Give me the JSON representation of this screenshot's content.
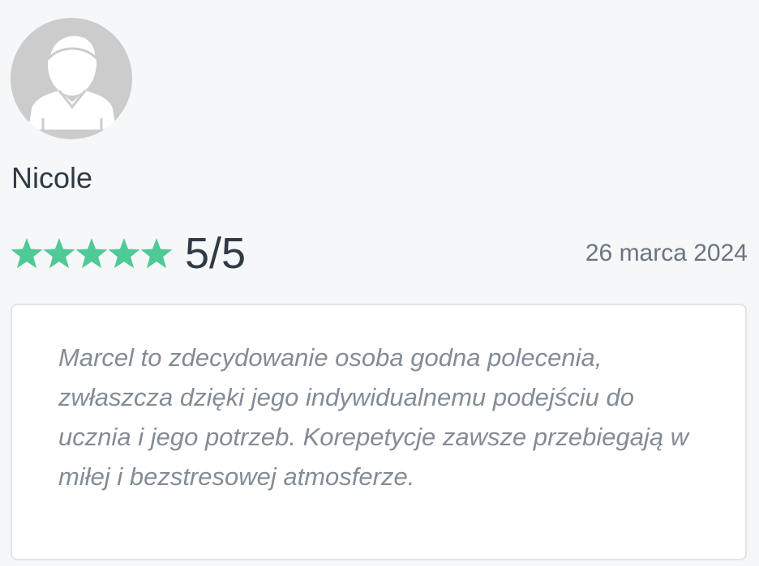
{
  "reviewer": {
    "avatar_icon": "user-avatar-icon",
    "name": "Nicole"
  },
  "rating": {
    "value": 5,
    "max": 5,
    "display": "5/5",
    "star_icon": "star-icon",
    "star_color": "#4fc995"
  },
  "review": {
    "date": "26 marca 2024",
    "text": "Marcel to zdecydowanie osoba godna polecenia, zwłaszcza dzięki jego indywidualnemu podejściu do ucznia i jego potrzeb. Korepetycje zawsze przebiegają w miłej i bezstresowej atmosferze."
  },
  "colors": {
    "background": "#f5f7f9",
    "text_primary": "#2f3a45",
    "text_muted": "#6b7580",
    "review_text": "#838c95",
    "avatar_bg": "#cccccc"
  }
}
